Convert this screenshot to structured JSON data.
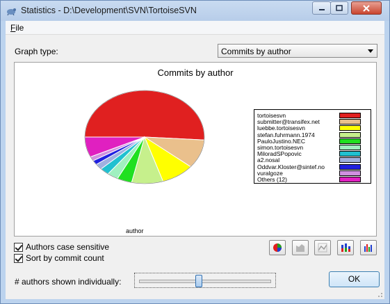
{
  "window": {
    "title": "Statistics - D:\\Development\\SVN\\TortoiseSVN",
    "icon": "tortoise-icon",
    "controls": [
      "minimize-icon",
      "maximize-icon",
      "close-icon"
    ]
  },
  "menu": {
    "file_label": "File",
    "file_accel": "F",
    "file_rest": "ile"
  },
  "graph_type": {
    "label": "Graph type:",
    "selected": "Commits by author"
  },
  "chart_data": {
    "type": "pie",
    "title": "Commits by author",
    "xlabel": "author",
    "legend_position": "right",
    "slices": [
      {
        "name": "tortoisesvn",
        "value": 51.0,
        "color": "#e02020"
      },
      {
        "name": "submitter@transifex.net",
        "value": 10.0,
        "color": "#eac08c"
      },
      {
        "name": "luebbe.tortoisesvn",
        "value": 9.0,
        "color": "#ffff00"
      },
      {
        "name": "stefan.fuhrmann.1974",
        "value": 8.5,
        "color": "#c6f08c"
      },
      {
        "name": "PauloJustino.NEC",
        "value": 4.0,
        "color": "#20e020"
      },
      {
        "name": "simon.tortoisesvn",
        "value": 3.0,
        "color": "#a0f0c0"
      },
      {
        "name": "MiloradSPopovic",
        "value": 2.5,
        "color": "#20c0d0"
      },
      {
        "name": "a2.nosal",
        "value": 2.0,
        "color": "#a0b0e0"
      },
      {
        "name": "Oddvar.Kloster@sintef.no",
        "value": 1.5,
        "color": "#2020e0"
      },
      {
        "name": "vuralgoze",
        "value": 1.5,
        "color": "#d090e0"
      },
      {
        "name": "Others (12)",
        "value": 7.0,
        "color": "#e020c0"
      }
    ]
  },
  "options": {
    "case_sensitive": {
      "label": "Authors case sensitive",
      "checked": true
    },
    "sort_by_count": {
      "label": "Sort by commit count",
      "checked": true
    }
  },
  "view_buttons": [
    "pie-chart-icon",
    "area-chart-icon",
    "line-chart-icon",
    "stacked-bar-chart-icon",
    "bar-chart-icon"
  ],
  "authors_slider": {
    "label": "# authors shown individually:",
    "level": 0.45
  },
  "ok_label": "OK"
}
